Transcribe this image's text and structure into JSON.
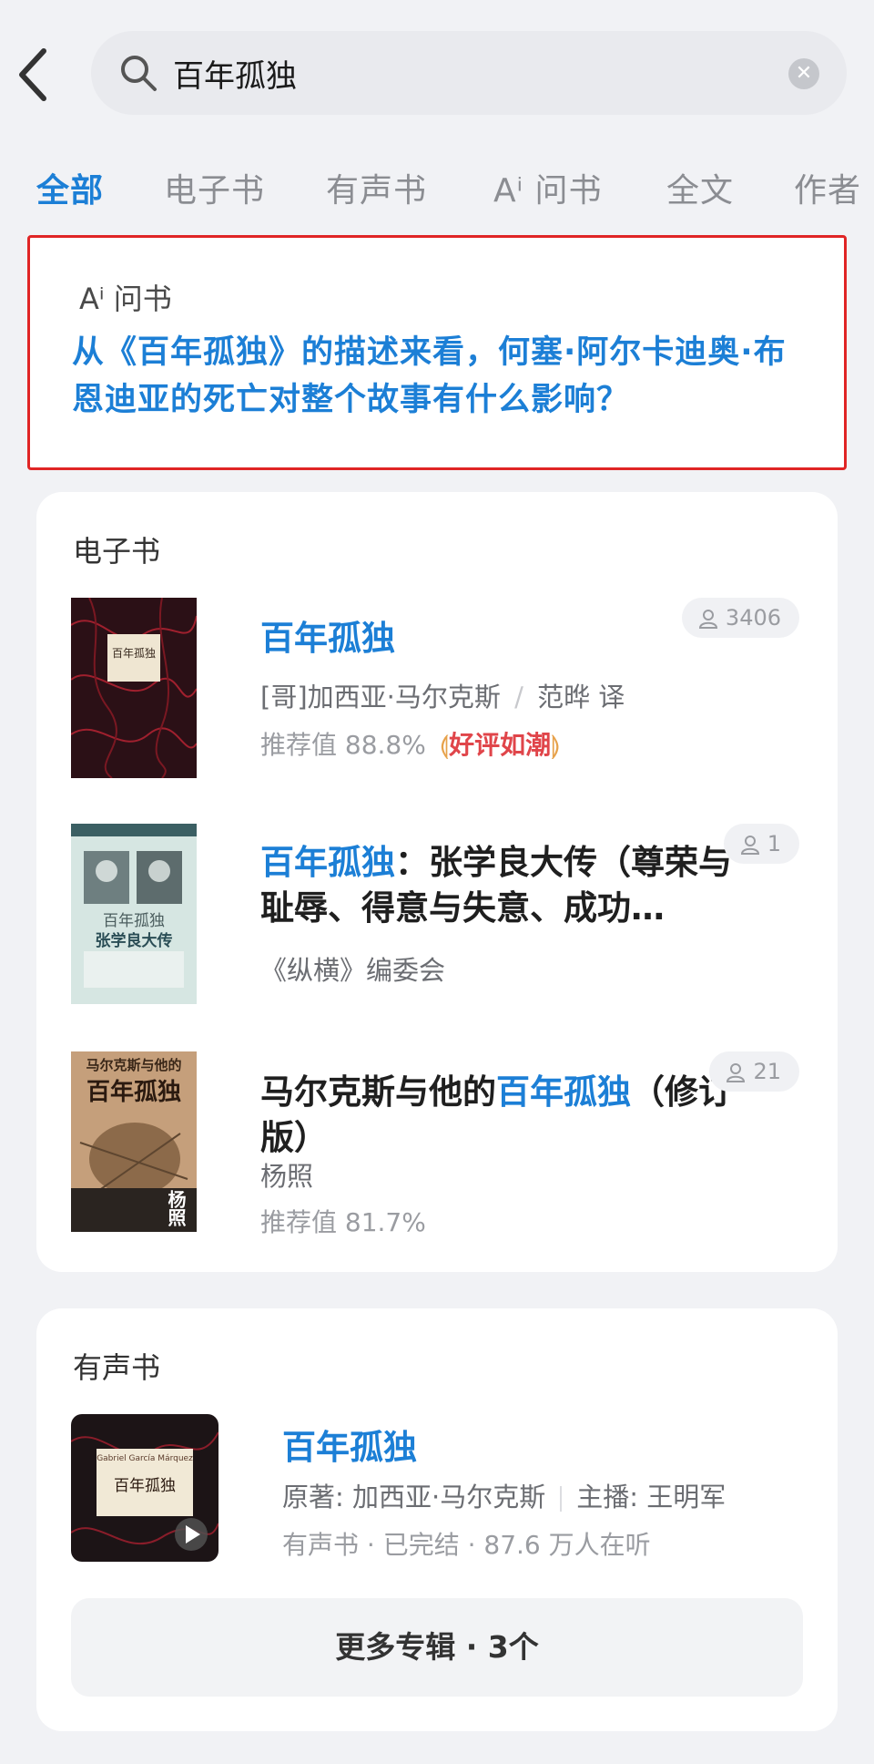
{
  "search": {
    "query": "百年孤独"
  },
  "tabs": [
    {
      "label": "全部"
    },
    {
      "label": "电子书"
    },
    {
      "label": "有声书"
    },
    {
      "label": "问书",
      "prefix": "Aⁱ"
    },
    {
      "label": "全文"
    },
    {
      "label": "作者"
    }
  ],
  "ai_card": {
    "prefix": "Aⁱ",
    "header": "问书",
    "question": "从《百年孤独》的描述来看，何塞·阿尔卡迪奥·布恩迪亚的死亡对整个故事有什么影响？"
  },
  "ebooks": {
    "section_title": "电子书",
    "items": [
      {
        "title_hl": "百年孤独",
        "author": "[哥]加西亚·马尔克斯",
        "translator": "范晔 译",
        "author_sep": "/",
        "recommend": "推荐值 88.8%",
        "tag": "好评如潮",
        "readers": "3406",
        "cover_text": "百年孤独"
      },
      {
        "title_hl": "百年孤独",
        "title_rest": "：张学良大传（尊荣与耻辱、得意与失意、成功…",
        "author": "《纵横》编委会",
        "readers": "1",
        "cover_title": "百年孤独",
        "cover_subtitle": "张学良大传"
      },
      {
        "title_pre": "马尔克斯与他的",
        "title_hl": "百年孤独",
        "title_post": "（修订版）",
        "author": "杨照",
        "recommend": "推荐值 81.7%",
        "readers": "21",
        "cover_title_top": "马尔克斯与他的",
        "cover_title_main": "百年孤独",
        "cover_author": "杨照"
      }
    ]
  },
  "audiobooks": {
    "section_title": "有声书",
    "item": {
      "title": "百年孤独",
      "original": "原著: 加西亚·马尔克斯",
      "narrator": "主播: 王明军",
      "meta": "有声书 · 已完结 · 87.6 万人在听",
      "cover_author_en": "Gabriel García Márquez",
      "cover_title": "百年孤独"
    },
    "more_label": "更多专辑 · 3个"
  },
  "colors": {
    "accent": "#1c7fd6",
    "highlight_border": "#e02525",
    "background": "#f1f2f5"
  }
}
